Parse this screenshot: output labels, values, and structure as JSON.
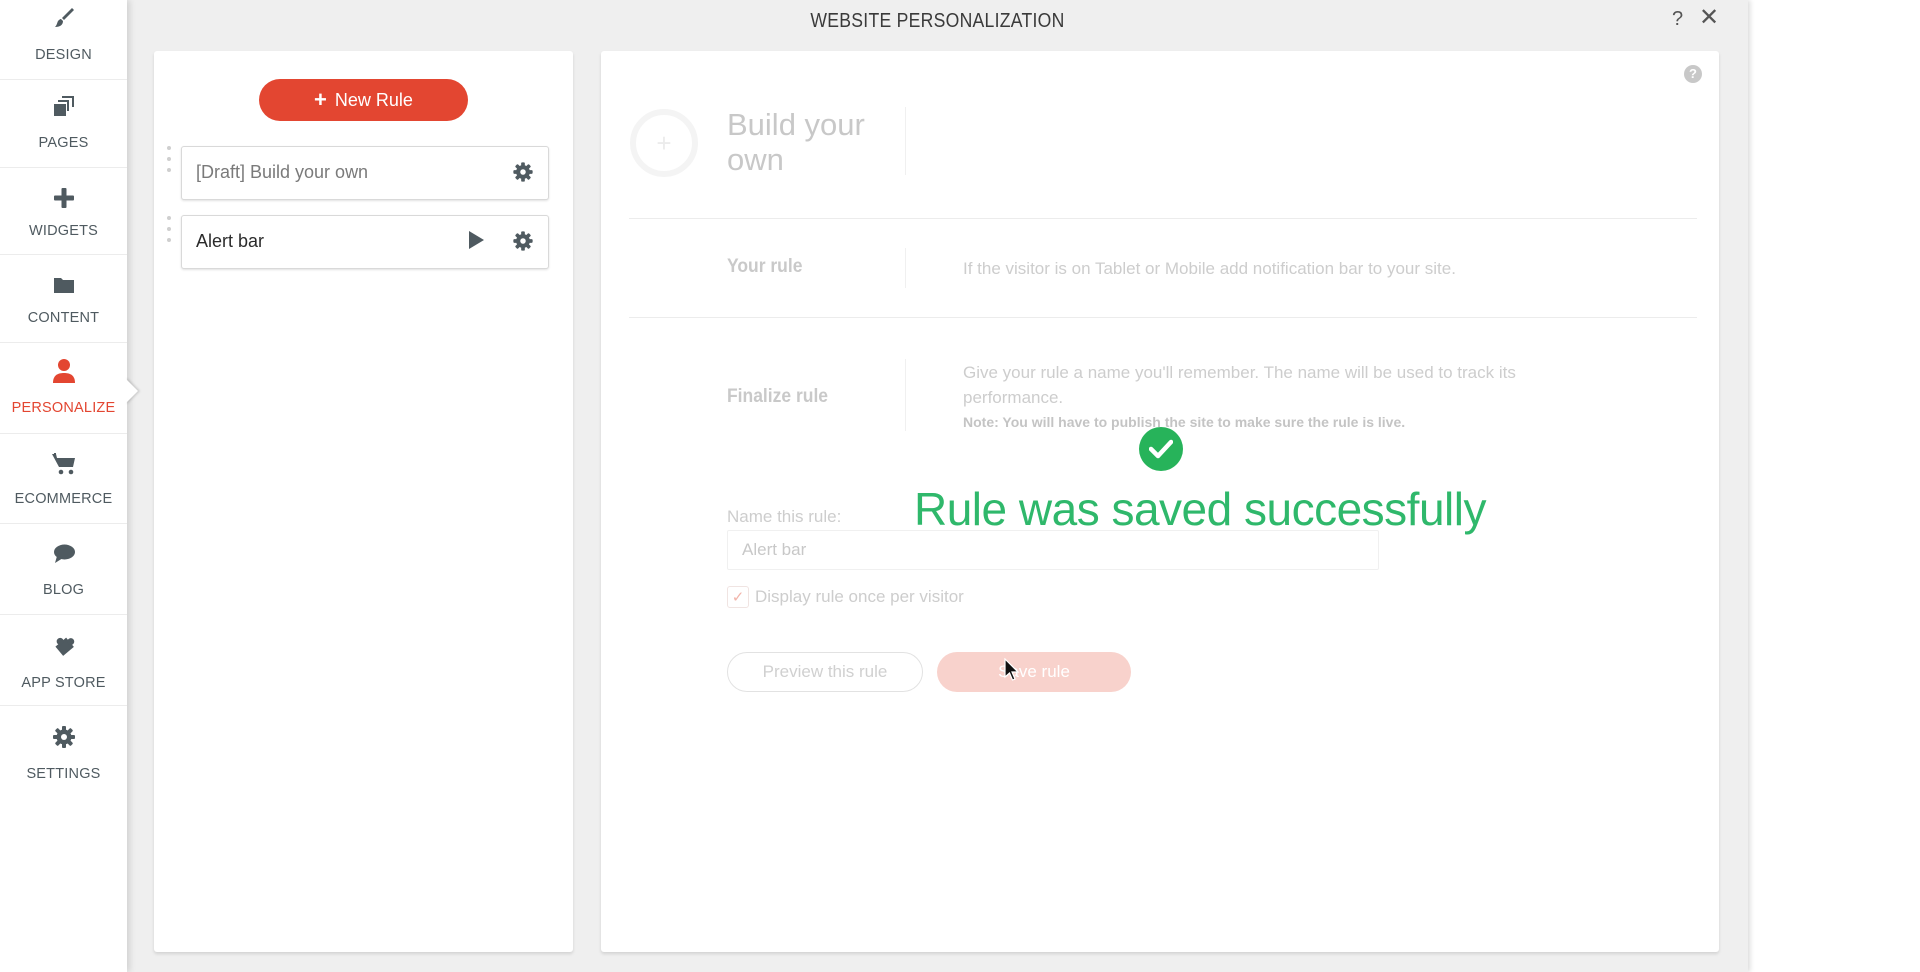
{
  "sidebar": {
    "items": [
      {
        "label": "DESIGN",
        "icon": "brush-icon",
        "active": false
      },
      {
        "label": "PAGES",
        "icon": "pages-icon",
        "active": false
      },
      {
        "label": "WIDGETS",
        "icon": "plus-icon",
        "active": false
      },
      {
        "label": "CONTENT",
        "icon": "folder-icon",
        "active": false
      },
      {
        "label": "PERSONALIZE",
        "icon": "user-icon",
        "active": true
      },
      {
        "label": "ECOMMERCE",
        "icon": "cart-icon",
        "active": false
      },
      {
        "label": "BLOG",
        "icon": "speech-bubble-icon",
        "active": false
      },
      {
        "label": "APP STORE",
        "icon": "puzzle-icon",
        "active": false
      },
      {
        "label": "SETTINGS",
        "icon": "gear-icon",
        "active": false
      }
    ]
  },
  "modal": {
    "title": "WEBSITE PERSONALIZATION",
    "help_label": "?",
    "close_label": "✕"
  },
  "rules_panel": {
    "new_rule_label": "New Rule",
    "rules": [
      {
        "name": "[Draft] Build your own",
        "status": "draft"
      },
      {
        "name": "Alert bar",
        "status": "live"
      }
    ]
  },
  "editor": {
    "help_icon": "?",
    "hero_icon": "+",
    "hero_title": "Build your own",
    "your_rule_label": "Your rule",
    "your_rule_text": "If the visitor is on Tablet or Mobile add notification bar to your site.",
    "finalize_label": "Finalize rule",
    "finalize_text": "Give your rule a name you'll remember. The name will be used to track its performance.",
    "finalize_note": "Note: You will have to publish the site to make sure the rule is live.",
    "name_label": "Name this rule:",
    "name_value": "Alert bar",
    "display_once_label": "Display rule once per visitor",
    "display_once_checked": true,
    "preview_label": "Preview this rule",
    "save_label": "Save rule"
  },
  "toast": {
    "message": "Rule was saved successfully"
  },
  "colors": {
    "accent": "#e34631",
    "success": "#2fb86b",
    "icon": "#4f5a60"
  }
}
